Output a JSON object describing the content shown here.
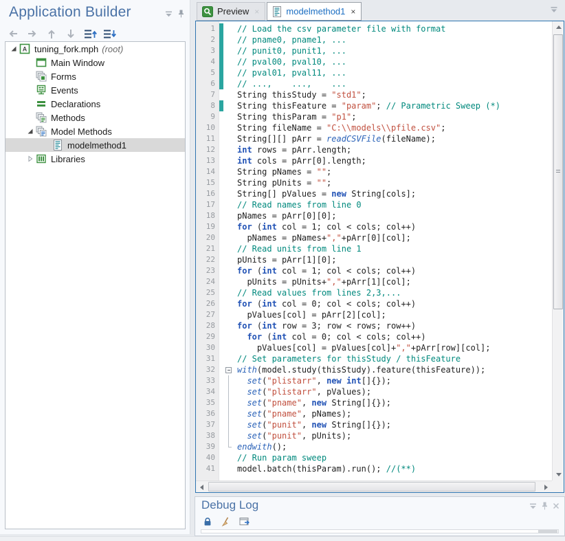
{
  "left_panel": {
    "title": "Application Builder",
    "toolbar": [
      {
        "icon": "nav-back"
      },
      {
        "icon": "nav-forward"
      },
      {
        "icon": "move-up"
      },
      {
        "icon": "move-down"
      },
      {
        "icon": "list-up"
      },
      {
        "icon": "list-down"
      }
    ],
    "tree": {
      "items": [
        {
          "label": "tuning_fork.mph",
          "suffix": "(root)",
          "icon": "app-root",
          "depth": 0,
          "expander": "expanded",
          "selected": false
        },
        {
          "label": "Main Window",
          "icon": "main-window",
          "depth": 1,
          "expander": "none",
          "selected": false
        },
        {
          "label": "Forms",
          "icon": "forms",
          "depth": 1,
          "expander": "none",
          "selected": false
        },
        {
          "label": "Events",
          "icon": "events",
          "depth": 1,
          "expander": "none",
          "selected": false
        },
        {
          "label": "Declarations",
          "icon": "declarations",
          "depth": 1,
          "expander": "none",
          "selected": false
        },
        {
          "label": "Methods",
          "icon": "methods",
          "depth": 1,
          "expander": "none",
          "selected": false
        },
        {
          "label": "Model Methods",
          "icon": "model-methods",
          "depth": 1,
          "expander": "expanded",
          "selected": false
        },
        {
          "label": "modelmethod1",
          "icon": "method-doc",
          "depth": 2,
          "expander": "none",
          "selected": true
        },
        {
          "label": "Libraries",
          "icon": "libraries",
          "depth": 1,
          "expander": "collapsed",
          "selected": false
        }
      ]
    }
  },
  "tabs": [
    {
      "label": "Preview",
      "icon": "preview",
      "active": false,
      "close": "×"
    },
    {
      "label": "modelmethod1",
      "icon": "method-doc",
      "active": true,
      "close": "×"
    }
  ],
  "editor": {
    "fold": {
      "start": 32,
      "end": 39
    },
    "changed_lines": [
      1,
      2,
      3,
      4,
      5,
      6,
      8
    ],
    "lines": [
      {
        "n": 1,
        "segs": [
          [
            "c",
            "// Load the csv parameter file with format"
          ]
        ]
      },
      {
        "n": 2,
        "segs": [
          [
            "c",
            "// pname0, pname1, ..."
          ]
        ]
      },
      {
        "n": 3,
        "segs": [
          [
            "c",
            "// punit0, punit1, ..."
          ]
        ]
      },
      {
        "n": 4,
        "segs": [
          [
            "c",
            "// pval00, pval10, ..."
          ]
        ]
      },
      {
        "n": 5,
        "segs": [
          [
            "c",
            "// pval01, pval11, ..."
          ]
        ]
      },
      {
        "n": 6,
        "segs": [
          [
            "c",
            "// ...,    ...,    ..."
          ]
        ]
      },
      {
        "n": 7,
        "segs": [
          [
            "p",
            "String thisStudy = "
          ],
          [
            "s",
            "\"std1\""
          ],
          [
            "p",
            ";"
          ]
        ]
      },
      {
        "n": 8,
        "segs": [
          [
            "p",
            "String thisFeature = "
          ],
          [
            "s",
            "\"param\""
          ],
          [
            "p",
            "; "
          ],
          [
            "c",
            "// Parametric Sweep (*)"
          ]
        ]
      },
      {
        "n": 9,
        "segs": [
          [
            "p",
            "String thisParam = "
          ],
          [
            "s",
            "\"p1\""
          ],
          [
            "p",
            ";"
          ]
        ]
      },
      {
        "n": 10,
        "segs": [
          [
            "p",
            "String fileName = "
          ],
          [
            "s",
            "\"C:\\\\models\\\\pfile.csv\""
          ],
          [
            "p",
            ";"
          ]
        ]
      },
      {
        "n": 11,
        "segs": [
          [
            "p",
            "String[][] pArr = "
          ],
          [
            "b",
            "readCSVFile"
          ],
          [
            "p",
            "(fileName);"
          ]
        ]
      },
      {
        "n": 12,
        "segs": [
          [
            "k",
            "int"
          ],
          [
            "p",
            " rows = pArr.length;"
          ]
        ]
      },
      {
        "n": 13,
        "segs": [
          [
            "k",
            "int"
          ],
          [
            "p",
            " cols = pArr[0].length;"
          ]
        ]
      },
      {
        "n": 14,
        "segs": [
          [
            "p",
            "String pNames = "
          ],
          [
            "s",
            "\"\""
          ],
          [
            "p",
            ";"
          ]
        ]
      },
      {
        "n": 15,
        "segs": [
          [
            "p",
            "String pUnits = "
          ],
          [
            "s",
            "\"\""
          ],
          [
            "p",
            ";"
          ]
        ]
      },
      {
        "n": 16,
        "segs": [
          [
            "p",
            "String[] pValues = "
          ],
          [
            "k",
            "new"
          ],
          [
            "p",
            " String[cols];"
          ]
        ]
      },
      {
        "n": 17,
        "segs": [
          [
            "c",
            "// Read names from line 0"
          ]
        ]
      },
      {
        "n": 18,
        "segs": [
          [
            "p",
            "pNames = pArr[0][0];"
          ]
        ]
      },
      {
        "n": 19,
        "segs": [
          [
            "k",
            "for"
          ],
          [
            "p",
            " ("
          ],
          [
            "k",
            "int"
          ],
          [
            "p",
            " col = 1; col < cols; col++)"
          ]
        ]
      },
      {
        "n": 20,
        "segs": [
          [
            "p",
            "  pNames = pNames+"
          ],
          [
            "s",
            "\",\""
          ],
          [
            "p",
            "+pArr[0][col];"
          ]
        ]
      },
      {
        "n": 21,
        "segs": [
          [
            "c",
            "// Read units from line 1"
          ]
        ]
      },
      {
        "n": 22,
        "segs": [
          [
            "p",
            "pUnits = pArr[1][0];"
          ]
        ]
      },
      {
        "n": 23,
        "segs": [
          [
            "k",
            "for"
          ],
          [
            "p",
            " ("
          ],
          [
            "k",
            "int"
          ],
          [
            "p",
            " col = 1; col < cols; col++)"
          ]
        ]
      },
      {
        "n": 24,
        "segs": [
          [
            "p",
            "  pUnits = pUnits+"
          ],
          [
            "s",
            "\",\""
          ],
          [
            "p",
            "+pArr[1][col];"
          ]
        ]
      },
      {
        "n": 25,
        "segs": [
          [
            "c",
            "// Read values from lines 2,3,..."
          ]
        ]
      },
      {
        "n": 26,
        "segs": [
          [
            "k",
            "for"
          ],
          [
            "p",
            " ("
          ],
          [
            "k",
            "int"
          ],
          [
            "p",
            " col = 0; col < cols; col++)"
          ]
        ]
      },
      {
        "n": 27,
        "segs": [
          [
            "p",
            "  pValues[col] = pArr[2][col];"
          ]
        ]
      },
      {
        "n": 28,
        "segs": [
          [
            "k",
            "for"
          ],
          [
            "p",
            " ("
          ],
          [
            "k",
            "int"
          ],
          [
            "p",
            " row = 3; row < rows; row++)"
          ]
        ]
      },
      {
        "n": 29,
        "segs": [
          [
            "p",
            "  "
          ],
          [
            "k",
            "for"
          ],
          [
            "p",
            " ("
          ],
          [
            "k",
            "int"
          ],
          [
            "p",
            " col = 0; col < cols; col++)"
          ]
        ]
      },
      {
        "n": 30,
        "segs": [
          [
            "p",
            "    pValues[col] = pValues[col]+"
          ],
          [
            "s",
            "\",\""
          ],
          [
            "p",
            "+pArr[row][col];"
          ]
        ]
      },
      {
        "n": 31,
        "segs": [
          [
            "c",
            "// Set parameters for thisStudy / thisFeature"
          ]
        ]
      },
      {
        "n": 32,
        "segs": [
          [
            "b",
            "with"
          ],
          [
            "p",
            "(model.study(thisStudy).feature(thisFeature));"
          ]
        ]
      },
      {
        "n": 33,
        "segs": [
          [
            "p",
            "  "
          ],
          [
            "b",
            "set"
          ],
          [
            "p",
            "("
          ],
          [
            "s",
            "\"plistarr\""
          ],
          [
            "p",
            ", "
          ],
          [
            "k",
            "new"
          ],
          [
            "p",
            " "
          ],
          [
            "k",
            "int"
          ],
          [
            "p",
            "[]{});"
          ]
        ]
      },
      {
        "n": 34,
        "segs": [
          [
            "p",
            "  "
          ],
          [
            "b",
            "set"
          ],
          [
            "p",
            "("
          ],
          [
            "s",
            "\"plistarr\""
          ],
          [
            "p",
            ", pValues);"
          ]
        ]
      },
      {
        "n": 35,
        "segs": [
          [
            "p",
            "  "
          ],
          [
            "b",
            "set"
          ],
          [
            "p",
            "("
          ],
          [
            "s",
            "\"pname\""
          ],
          [
            "p",
            ", "
          ],
          [
            "k",
            "new"
          ],
          [
            "p",
            " String[]{});"
          ]
        ]
      },
      {
        "n": 36,
        "segs": [
          [
            "p",
            "  "
          ],
          [
            "b",
            "set"
          ],
          [
            "p",
            "("
          ],
          [
            "s",
            "\"pname\""
          ],
          [
            "p",
            ", pNames);"
          ]
        ]
      },
      {
        "n": 37,
        "segs": [
          [
            "p",
            "  "
          ],
          [
            "b",
            "set"
          ],
          [
            "p",
            "("
          ],
          [
            "s",
            "\"punit\""
          ],
          [
            "p",
            ", "
          ],
          [
            "k",
            "new"
          ],
          [
            "p",
            " String[]{});"
          ]
        ]
      },
      {
        "n": 38,
        "segs": [
          [
            "p",
            "  "
          ],
          [
            "b",
            "set"
          ],
          [
            "p",
            "("
          ],
          [
            "s",
            "\"punit\""
          ],
          [
            "p",
            ", pUnits);"
          ]
        ]
      },
      {
        "n": 39,
        "segs": [
          [
            "b",
            "endwith"
          ],
          [
            "p",
            "();"
          ]
        ]
      },
      {
        "n": 40,
        "segs": [
          [
            "c",
            "// Run param sweep"
          ]
        ]
      },
      {
        "n": 41,
        "segs": [
          [
            "p",
            "model.batch(thisParam).run(); "
          ],
          [
            "c",
            "//(**)"
          ]
        ]
      }
    ]
  },
  "debug_panel": {
    "title": "Debug Log",
    "toolbar": [
      {
        "icon": "lock"
      },
      {
        "icon": "clear-log"
      },
      {
        "icon": "export-log"
      }
    ]
  },
  "colors": {
    "title_blue": "#4a72a6",
    "tab_active_blue": "#1b6ec2",
    "editor_border": "#2e74b0",
    "comment": "#00897d",
    "string": "#c1503f",
    "keyword": "#2152b5",
    "builtin": "#2a62b8",
    "change_bar": "#2aa5a0",
    "tree_green": "#3d9140",
    "selection_gray": "#d9d9d9"
  }
}
